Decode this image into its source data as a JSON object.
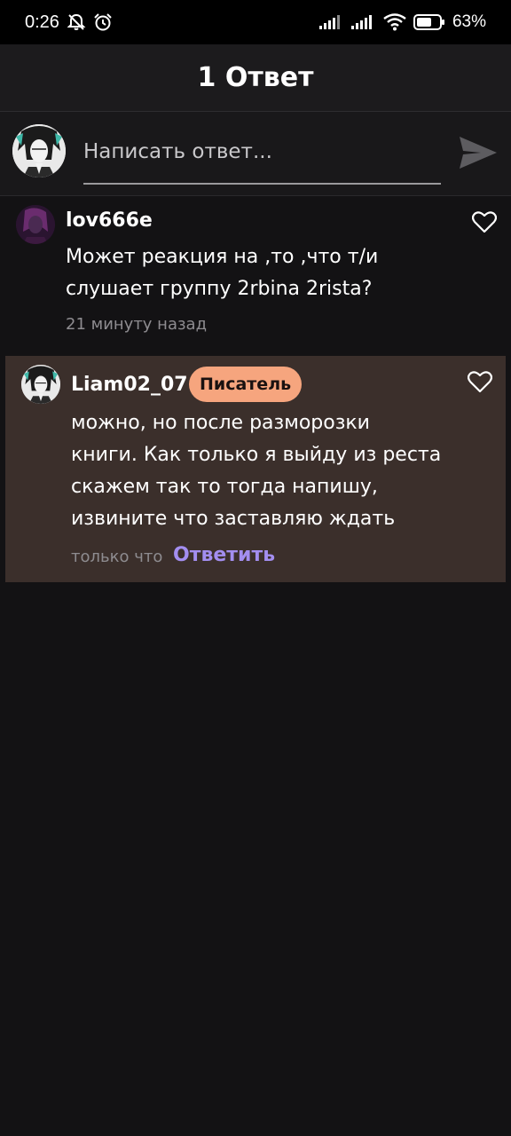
{
  "status": {
    "time": "0:26",
    "battery": "63%"
  },
  "header": {
    "title": "1 Ответ"
  },
  "composer": {
    "placeholder": "Написать ответ..."
  },
  "comments": [
    {
      "username": "lov666e",
      "lines": [
        "Может реакция на ,то ,что т/и",
        "слушает группу 2rbina 2rista?"
      ],
      "time": "21 минуту назад"
    },
    {
      "username": "Liam02_07",
      "badge": "Писатель",
      "lines": [
        "можно, но после разморозки",
        "книги. Как только я выйду из реста",
        "скажем так то тогда напишу,",
        "извините что заставляю ждать"
      ],
      "time": "только что",
      "reply_label": "Ответить"
    }
  ],
  "colors": {
    "background": "#131214",
    "highlight": "#3b2f2b",
    "badge": "#f6a57e",
    "reply": "#a38ef0"
  },
  "icons": [
    "mute-icon",
    "alarm-icon",
    "signal-icon",
    "wifi-icon",
    "battery-icon",
    "send-icon",
    "heart-icon"
  ]
}
